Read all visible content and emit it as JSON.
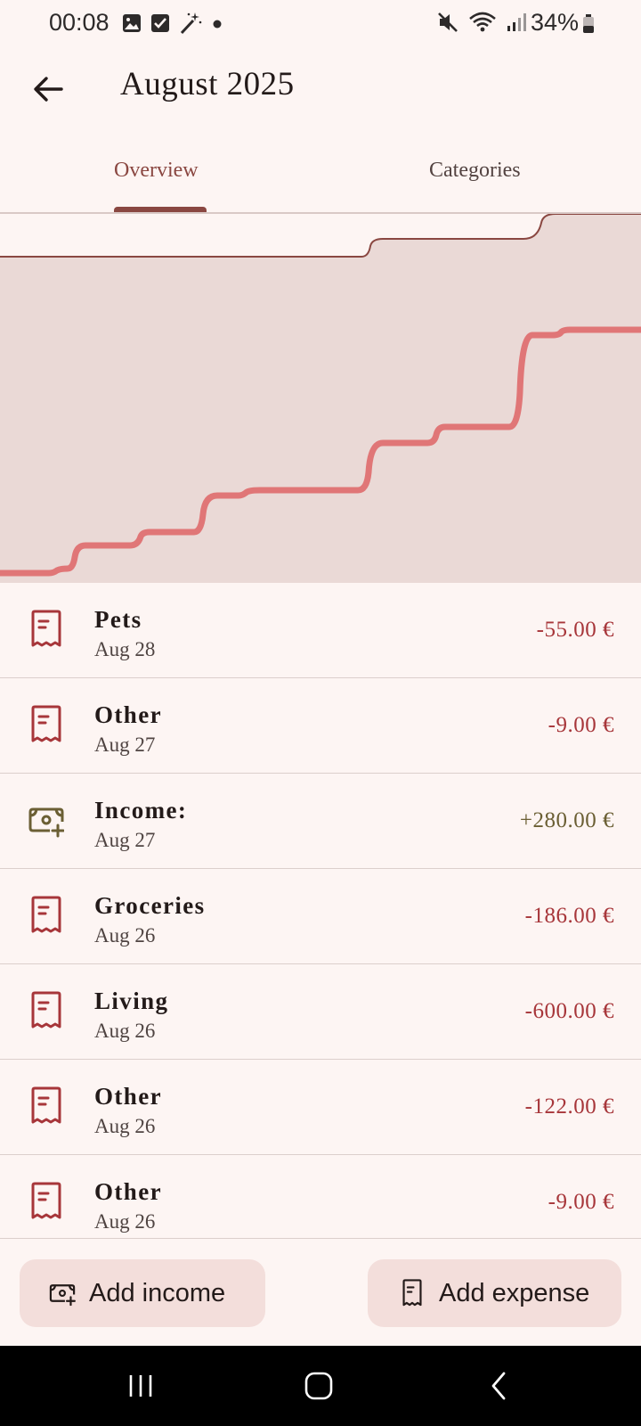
{
  "status_bar": {
    "time": "00:08",
    "battery": "34%",
    "left_icons": [
      "image-icon",
      "check-box-icon",
      "magic-wand-icon",
      "dot-icon"
    ],
    "right_icons": [
      "mute-icon",
      "wifi-icon",
      "signal-icon",
      "battery-icon"
    ]
  },
  "header": {
    "title": "August 2025"
  },
  "tabs": [
    {
      "label": "Overview",
      "active": true
    },
    {
      "label": "Categories",
      "active": false
    }
  ],
  "chart_data": {
    "type": "area",
    "title": "",
    "xlabel": "",
    "ylabel": "",
    "series": [
      {
        "kind": "budget-area",
        "color": "#ead9d6",
        "line_color": "#8a4741",
        "steps": [
          0.886,
          0.922,
          1.0
        ]
      },
      {
        "kind": "cumulative-spending",
        "color": "#e07677",
        "steps": [
          0.0,
          0.02,
          0.096,
          0.136,
          0.233,
          0.246,
          0.376,
          0.418,
          0.683,
          0.696
        ]
      }
    ]
  },
  "transactions": [
    {
      "name": "Pets",
      "date": "Aug 28",
      "amount": "-55.00 €",
      "type": "expense",
      "icon": "receipt-icon"
    },
    {
      "name": "Other",
      "date": "Aug 27",
      "amount": "-9.00 €",
      "type": "expense",
      "icon": "receipt-icon"
    },
    {
      "name": "Income:",
      "date": "Aug 27",
      "amount": "+280.00 €",
      "type": "income",
      "icon": "cash-plus-icon"
    },
    {
      "name": "Groceries",
      "date": "Aug 26",
      "amount": "-186.00 €",
      "type": "expense",
      "icon": "receipt-icon"
    },
    {
      "name": "Living",
      "date": "Aug 26",
      "amount": "-600.00 €",
      "type": "expense",
      "icon": "receipt-icon"
    },
    {
      "name": "Other",
      "date": "Aug 26",
      "amount": "-122.00 €",
      "type": "expense",
      "icon": "receipt-icon"
    },
    {
      "name": "Other",
      "date": "Aug 26",
      "amount": "-9.00 €",
      "type": "expense",
      "icon": "receipt-icon"
    }
  ],
  "actions": {
    "add_income": "Add income",
    "add_expense": "Add expense"
  },
  "colors": {
    "background": "#fdf5f3",
    "primary": "#8a4741",
    "expense": "#a7363a",
    "income": "#6b5f34",
    "button_bg": "#f3dedb"
  }
}
